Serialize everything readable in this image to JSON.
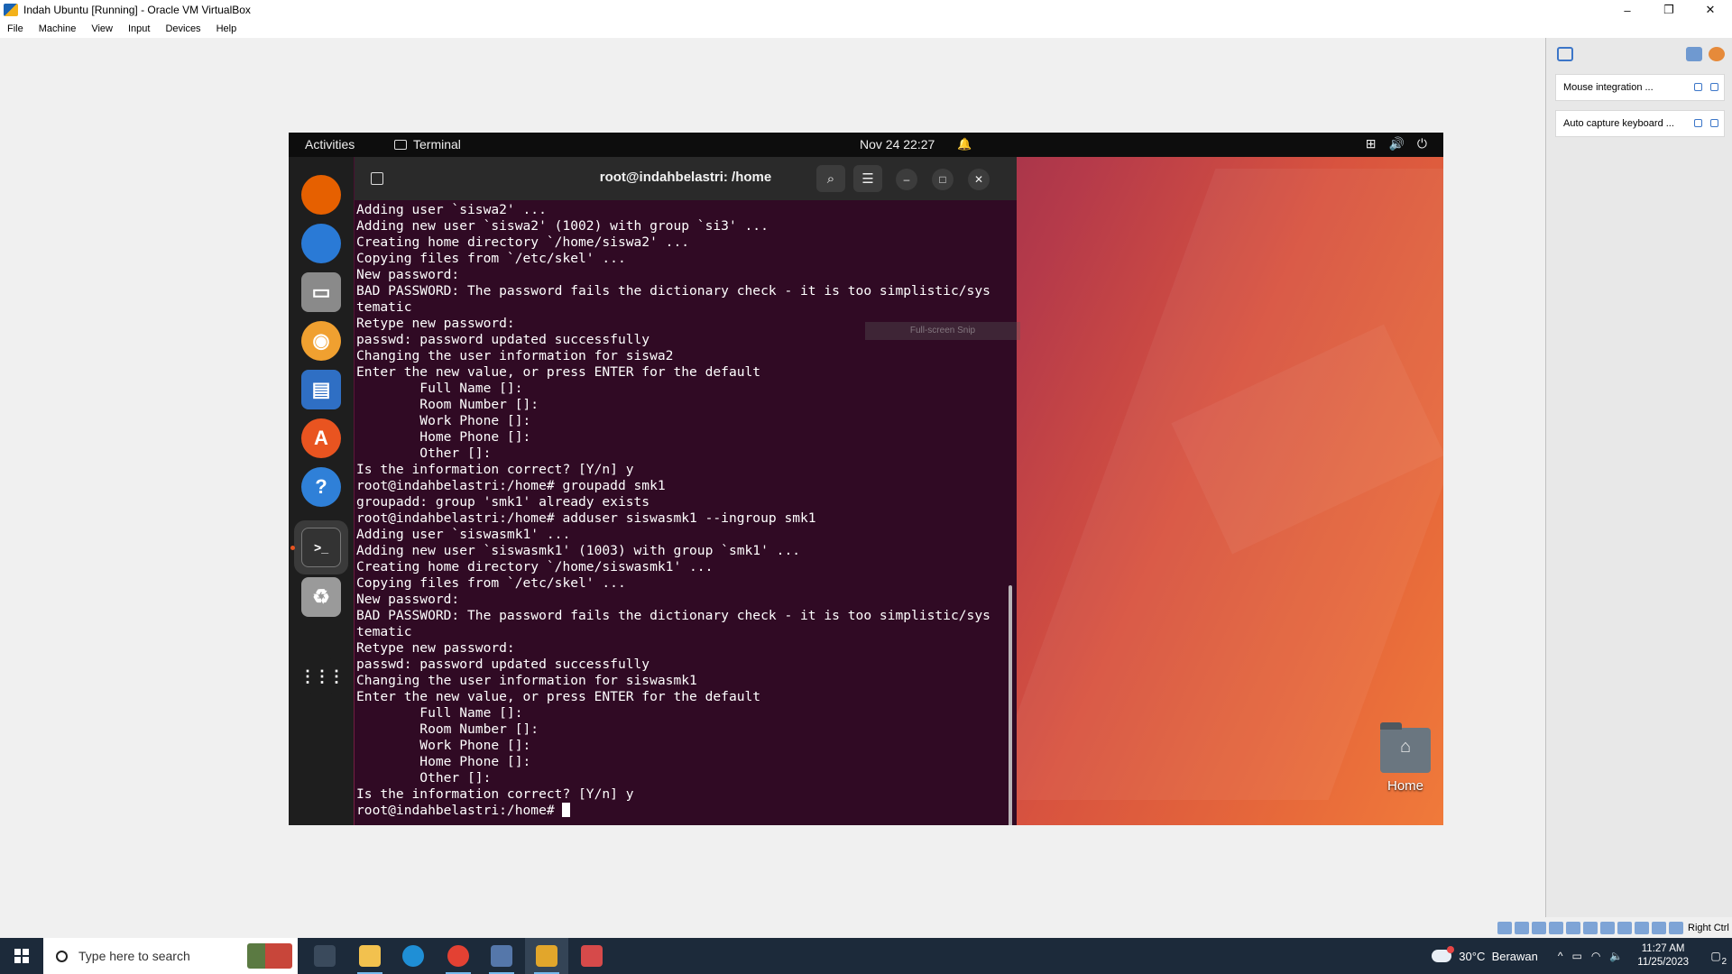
{
  "host": {
    "title": "Indah Ubuntu [Running] - Oracle VM VirtualBox",
    "menu": [
      "File",
      "Machine",
      "View",
      "Input",
      "Devices",
      "Help"
    ],
    "controls": {
      "minimize": "–",
      "restore": "❐",
      "close": "✕"
    }
  },
  "guest": {
    "topbar": {
      "activities": "Activities",
      "app_name": "Terminal",
      "clock": "Nov 24  22:27",
      "bell": "🔔",
      "tray": {
        "network": "⊞",
        "volume": "🔊",
        "power": "⏻"
      }
    },
    "dock": [
      {
        "name": "firefox",
        "color": "#e66000"
      },
      {
        "name": "thunderbird",
        "color": "#2a7ad6"
      },
      {
        "name": "files",
        "color": "#8a8a8a"
      },
      {
        "name": "rhythmbox",
        "color": "#f0a030"
      },
      {
        "name": "writer",
        "color": "#2f6fc4"
      },
      {
        "name": "app-center",
        "color": "#e95420"
      },
      {
        "name": "help",
        "color": "#2f80d8"
      },
      {
        "name": "terminal",
        "color": "#333333"
      },
      {
        "name": "trash",
        "color": "#9a9a9a"
      },
      {
        "name": "show-apps",
        "color": "#1e1e1e"
      }
    ],
    "dock_glyphs": {
      "help": "?",
      "app-center": "A",
      "terminal": ">_",
      "trash": "♻",
      "files": "▭",
      "writer": "▤",
      "rhythmbox": "◉",
      "show-apps": "⋮⋮⋮"
    },
    "terminal": {
      "title": "root@indahbelastri: /home",
      "search": "⌕",
      "menu": "☰",
      "minimize": "–",
      "maximize": "□",
      "close": "✕",
      "lines": [
        "Adding user `siswa2' ...",
        "Adding new user `siswa2' (1002) with group `si3' ...",
        "Creating home directory `/home/siswa2' ...",
        "Copying files from `/etc/skel' ...",
        "New password:",
        "BAD PASSWORD: The password fails the dictionary check - it is too simplistic/sys",
        "tematic",
        "Retype new password:",
        "passwd: password updated successfully",
        "Changing the user information for siswa2",
        "Enter the new value, or press ENTER for the default",
        "        Full Name []:",
        "        Room Number []:",
        "        Work Phone []:",
        "        Home Phone []:",
        "        Other []:",
        "Is the information correct? [Y/n] y",
        "root@indahbelastri:/home# groupadd smk1",
        "groupadd: group 'smk1' already exists",
        "root@indahbelastri:/home# adduser siswasmk1 --ingroup smk1",
        "Adding user `siswasmk1' ...",
        "Adding new user `siswasmk1' (1003) with group `smk1' ...",
        "Creating home directory `/home/siswasmk1' ...",
        "Copying files from `/etc/skel' ...",
        "New password:",
        "BAD PASSWORD: The password fails the dictionary check - it is too simplistic/sys",
        "tematic",
        "Retype new password:",
        "passwd: password updated successfully",
        "Changing the user information for siswasmk1",
        "Enter the new value, or press ENTER for the default",
        "        Full Name []:",
        "        Room Number []:",
        "        Work Phone []:",
        "        Home Phone []:",
        "        Other []:",
        "Is the information correct? [Y/n] y"
      ],
      "prompt": "root@indahbelastri:/home# ",
      "overlay_text": "Full-screen Snip"
    },
    "desktop_home_label": "Home",
    "home_glyph": "⌂"
  },
  "vbox_panel": {
    "messages": [
      "Mouse integration ...",
      "Auto capture keyboard ..."
    ]
  },
  "vbox_status": {
    "host_key": "Right Ctrl"
  },
  "taskbar": {
    "search_placeholder": "Type here to search",
    "apps": [
      {
        "name": "task-view",
        "color": "#3a4a5c"
      },
      {
        "name": "file-explorer",
        "color": "#f2c14e"
      },
      {
        "name": "edge",
        "color": "#1f8fd6"
      },
      {
        "name": "chrome",
        "color": "#e34133"
      },
      {
        "name": "virtualbox",
        "color": "#5577aa"
      },
      {
        "name": "virtualbox-vm",
        "color": "#e2a62b"
      },
      {
        "name": "snipping-tool",
        "color": "#d64a4a"
      }
    ],
    "weather": {
      "temp": "30°C",
      "condition": "Berawan"
    },
    "tray_icons": {
      "chevron": "^",
      "display": "▭",
      "network": "◠",
      "volume": "🔈"
    },
    "time": "11:27 AM",
    "date": "11/25/2023",
    "notifications": "2",
    "notif_glyph": "▢"
  }
}
